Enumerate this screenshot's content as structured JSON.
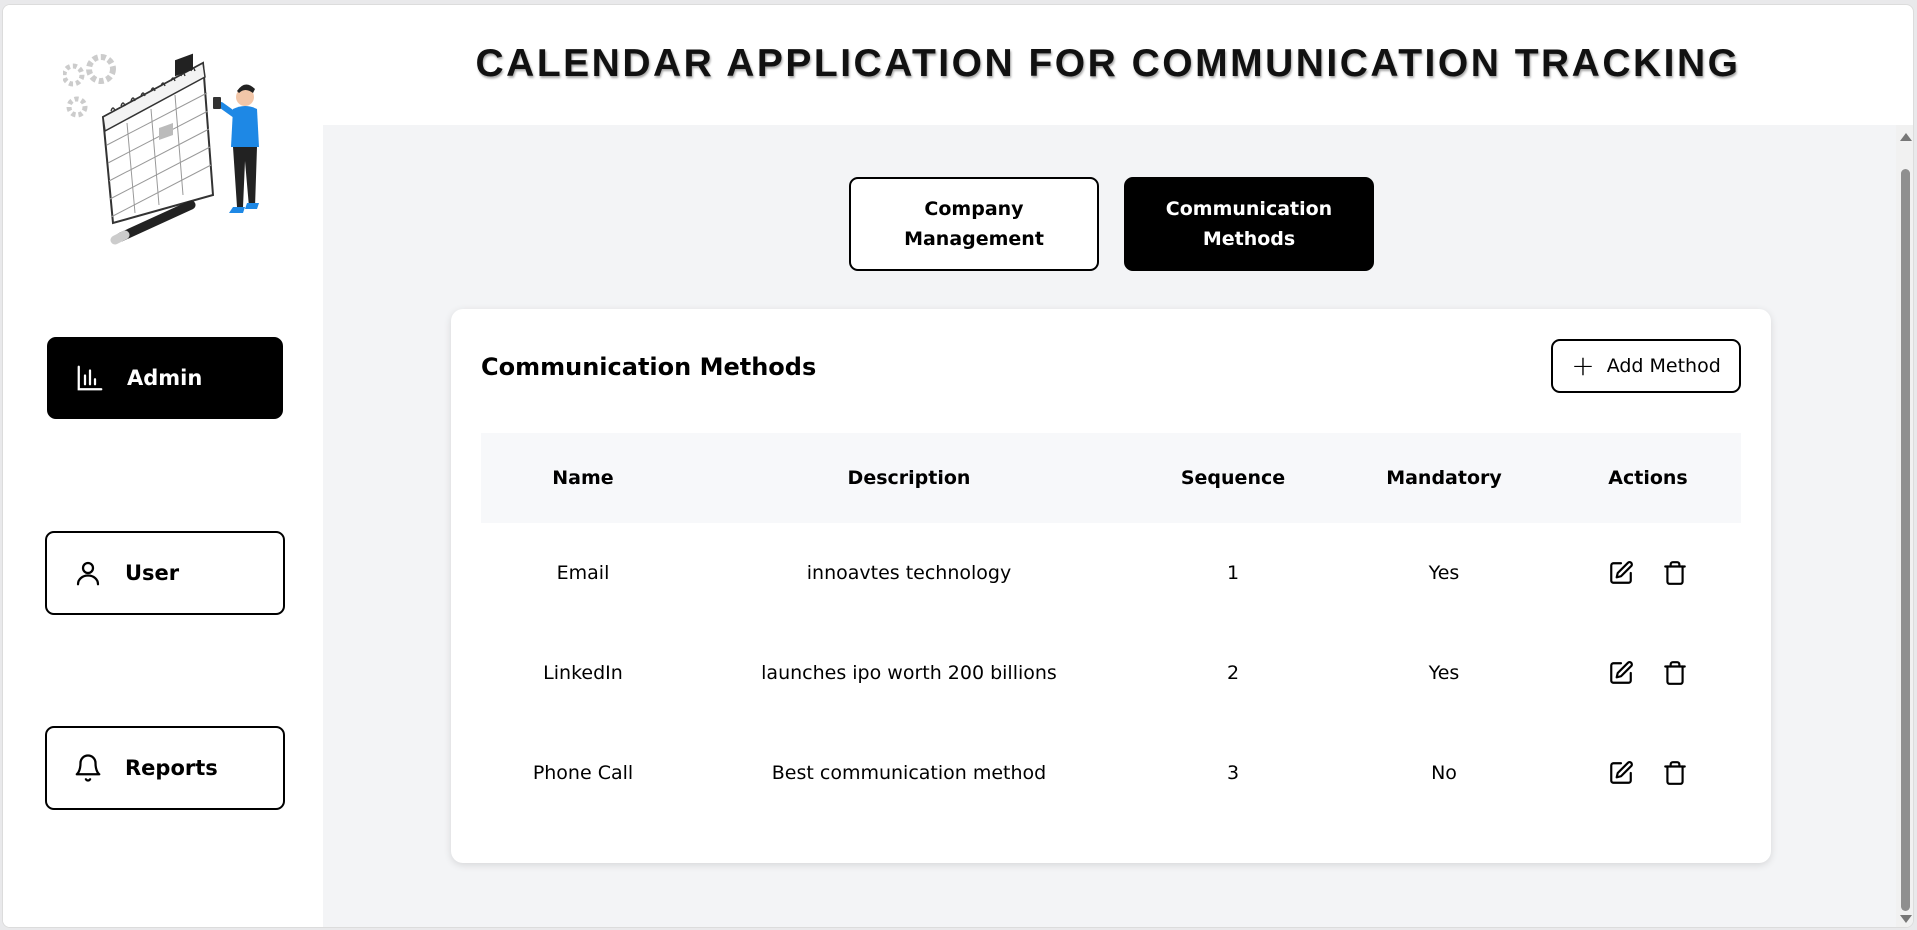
{
  "app_title": "CALENDAR APPLICATION FOR COMMUNICATION TRACKING",
  "sidebar": {
    "logo_icon": "calendar-illustration",
    "items": [
      {
        "label": "Admin",
        "icon": "bar-chart-icon",
        "active": true
      },
      {
        "label": "User",
        "icon": "user-icon",
        "active": false
      },
      {
        "label": "Reports",
        "icon": "bell-icon",
        "active": false
      }
    ]
  },
  "tabs": [
    {
      "label": "Company Management",
      "active": false
    },
    {
      "label": "Communication Methods",
      "active": true
    }
  ],
  "panel": {
    "title": "Communication Methods",
    "add_button_label": "Add Method",
    "columns": [
      "Name",
      "Description",
      "Sequence",
      "Mandatory",
      "Actions"
    ],
    "rows": [
      {
        "name": "Email",
        "description": "innoavtes technology",
        "sequence": "1",
        "mandatory": "Yes"
      },
      {
        "name": "LinkedIn",
        "description": "launches ipo worth 200 billions",
        "sequence": "2",
        "mandatory": "Yes"
      },
      {
        "name": "Phone Call",
        "description": "Best communication method",
        "sequence": "3",
        "mandatory": "No"
      }
    ]
  },
  "colors": {
    "accent": "#000000",
    "background": "#f3f4f6",
    "card": "#ffffff",
    "figure_blue": "#1e88e5"
  }
}
